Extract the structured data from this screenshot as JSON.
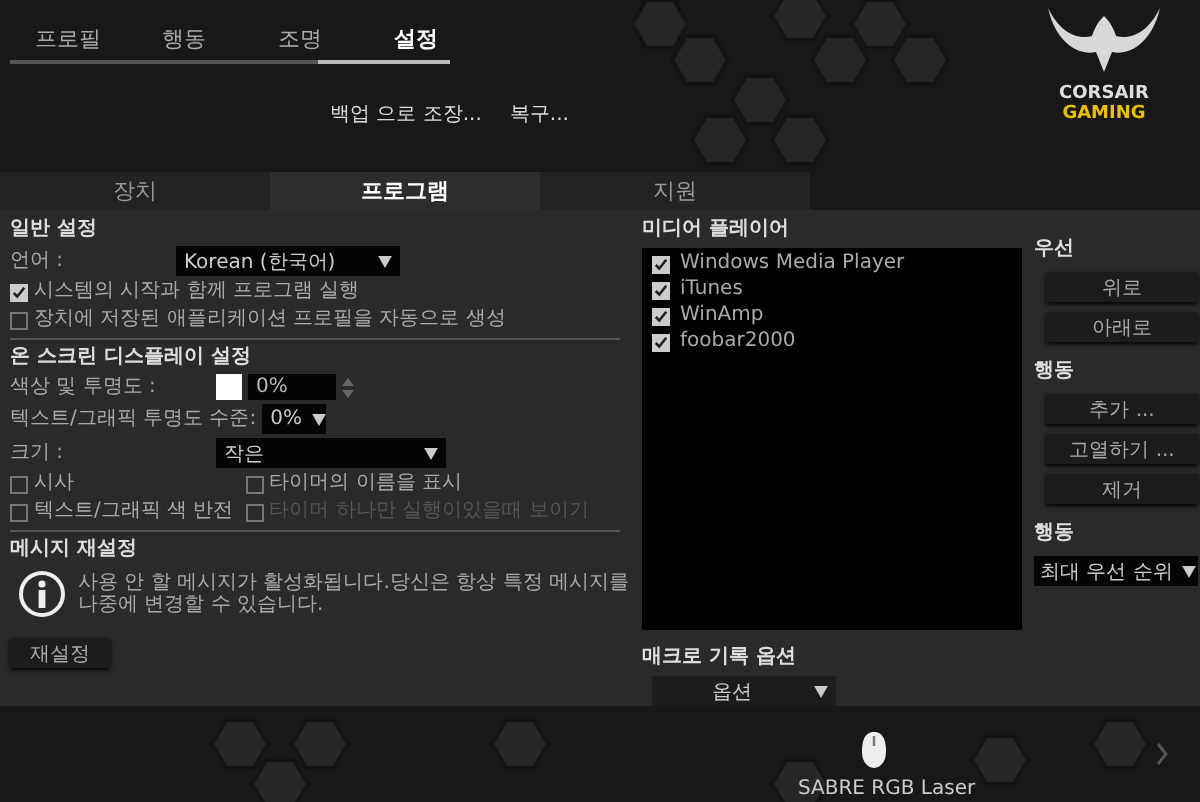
{
  "nav_tabs": [
    {
      "label": "프로필",
      "selected": false
    },
    {
      "label": "행동",
      "selected": false
    },
    {
      "label": "조명",
      "selected": false
    },
    {
      "label": "설정",
      "selected": true
    }
  ],
  "sub_links": [
    "백업 으로 조장...",
    "복구..."
  ],
  "logo": {
    "line1": "CORSAIR",
    "line2": "GAMING"
  },
  "section_tabs": [
    {
      "label": "장치",
      "selected": false
    },
    {
      "label": "프로그램",
      "selected": true
    },
    {
      "label": "지원",
      "selected": false
    }
  ],
  "general": {
    "title": "일반 설정",
    "language_label": "언어 :",
    "language_value": "Korean (한국어)",
    "options": [
      {
        "label": "시스템의 시작과 함께 프로그램 실행",
        "checked": true
      },
      {
        "label": "장치에 저장된 애플리케이션 프로필을 자동으로 생성",
        "checked": false
      }
    ]
  },
  "osd": {
    "title": "온 스크린 디스플레이 설정",
    "color_label": "색상 및 투명도 :",
    "color_value": "0%",
    "text_opacity_label": "텍스트/그래픽 투명도 수준:",
    "text_opacity_value": "0%",
    "size_label": "크기 :",
    "size_value": "작은",
    "options": [
      {
        "label": "시사",
        "checked": false,
        "disabled": false
      },
      {
        "label": "타이머의 이름을 표시",
        "checked": false,
        "disabled": false
      },
      {
        "label": "텍스트/그래픽 색 반전",
        "checked": false,
        "disabled": false
      },
      {
        "label": "타이머 하나만 실행이있을때 보이기",
        "checked": false,
        "disabled": true
      }
    ]
  },
  "message_reset": {
    "title": "메시지 재설정",
    "info": "사용 안 할 메시지가 활성화됩니다.당신은 항상 특정 메시지를 나중에 변경할 수 있습니다.",
    "button": "재설정"
  },
  "media_players": {
    "title": "미디어 플레이어",
    "items": [
      {
        "label": "Windows Media Player",
        "checked": true
      },
      {
        "label": "iTunes",
        "checked": true
      },
      {
        "label": "WinAmp",
        "checked": true
      },
      {
        "label": "foobar2000",
        "checked": true
      }
    ]
  },
  "priority": {
    "title": "우선",
    "buttons": [
      "위로",
      "아래로"
    ]
  },
  "actions": {
    "title": "행동",
    "buttons": [
      "추가 ...",
      "고열하기 ...",
      "제거"
    ]
  },
  "behavior": {
    "title": "행동",
    "value": "최대 우선 순위"
  },
  "macro": {
    "title": "매크로 기록 옵션",
    "value": "옵션"
  },
  "device": {
    "name": "SABRE RGB Laser"
  }
}
